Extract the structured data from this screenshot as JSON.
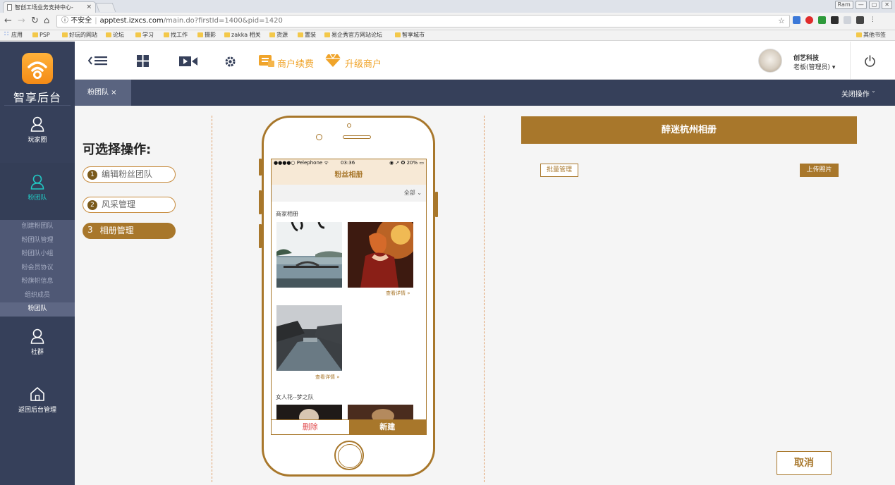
{
  "browser": {
    "tab_title": "智创工场业务支持中心-",
    "tab_close": "×",
    "url_insecure": "不安全",
    "url_host": "apptest.izxcs.com",
    "url_path": "/main.do?firstId=1400&pid=1420",
    "window_buttons": [
      "Ram",
      "—",
      "▢",
      "✕"
    ],
    "bookmarks": [
      "应用",
      "PSP",
      "好玩的网站",
      "论坛",
      "学习",
      "找工作",
      "摄影",
      "zakka 相关",
      "货源",
      "置装",
      "易企秀官方网站论坛",
      "智享城市"
    ],
    "other_bookmarks": "其他书签"
  },
  "sidebar": {
    "brand": "智享后台",
    "items": [
      {
        "label": "玩家圈",
        "icon": "user-icon"
      },
      {
        "label": "粉团队",
        "icon": "user-icon"
      },
      {
        "label": "社群",
        "icon": "user-icon"
      },
      {
        "label": "返回后台管理",
        "icon": "home-icon"
      }
    ],
    "submenu": [
      "创建粉团队",
      "粉团队管理",
      "粉团队小组",
      "粉会员协议",
      "粉旗帜信息",
      "组织成员",
      "粉团队"
    ]
  },
  "header": {
    "renew_label": "商户续费",
    "upgrade_label": "升级商户",
    "user_name": "创艺科技",
    "user_role": "老板(管理员) ▾"
  },
  "tabstrip": {
    "tab_label": "粉团队 ×",
    "close_ops": "关闭操作 ˇ"
  },
  "ops": {
    "title": "可选择操作:",
    "items": [
      {
        "num": "1",
        "label": "编辑粉丝团队"
      },
      {
        "num": "2",
        "label": "风采管理"
      },
      {
        "num": "3",
        "label": "相册管理"
      }
    ]
  },
  "phone": {
    "status_left": "●●●●○ Pelephone ᯤ",
    "status_time": "03:36",
    "status_right": "◉ ➚ ✪ 20% ▭",
    "app_title": "粉丝相册",
    "filter_label": "全部 ⌄",
    "section1": "商家相册",
    "section2": "女人花--梦之队",
    "detail_link": "查看详情 »",
    "delete_label": "删除",
    "new_label": "新建"
  },
  "album": {
    "title": "醉迷杭州相册",
    "batch_label": "批量管理",
    "upload_label": "上传照片",
    "cancel_label": "取消"
  },
  "colors": {
    "accent": "#a8772b",
    "sidebar": "#36405a",
    "active_teal": "#21c7c2",
    "orange": "#f0a42a"
  }
}
